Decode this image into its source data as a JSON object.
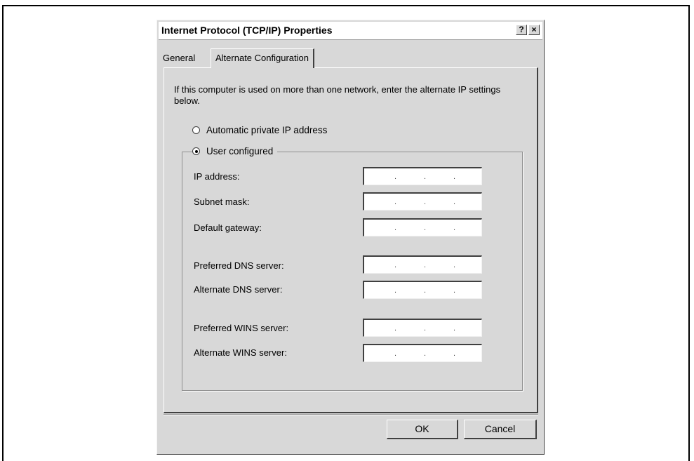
{
  "dialog": {
    "title": "Internet Protocol (TCP/IP) Properties",
    "help_label": "?",
    "close_label": "×"
  },
  "tabs": [
    {
      "label": "General",
      "active": false
    },
    {
      "label": "Alternate Configuration",
      "active": true
    }
  ],
  "intro_text": "If this computer is used on more than one network, enter the alternate IP settings below.",
  "options": {
    "automatic": {
      "label": "Automatic private IP address",
      "checked": false
    },
    "user": {
      "label": "User configured",
      "checked": true
    }
  },
  "fields": [
    {
      "label": "IP address:",
      "value": ""
    },
    {
      "label": "Subnet mask:",
      "value": ""
    },
    {
      "label": "Default gateway:",
      "value": ""
    },
    {
      "label": "Preferred DNS server:",
      "value": ""
    },
    {
      "label": "Alternate DNS server:",
      "value": ""
    },
    {
      "label": "Preferred WINS server:",
      "value": ""
    },
    {
      "label": "Alternate WINS server:",
      "value": ""
    }
  ],
  "ip_placeholder_dot": ".",
  "buttons": {
    "ok_label": "OK",
    "cancel_label": "Cancel"
  }
}
